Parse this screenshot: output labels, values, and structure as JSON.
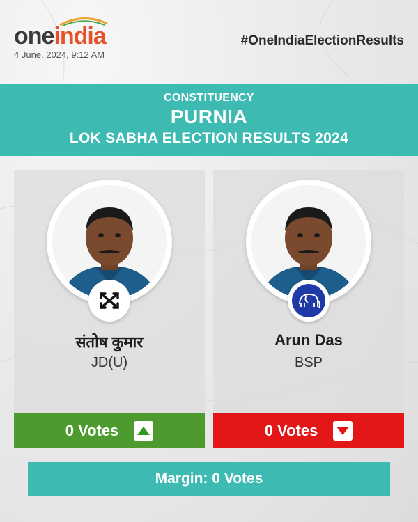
{
  "header": {
    "logo": {
      "part1": "one",
      "part2": "india"
    },
    "date": "4 June, 2024, 9:12 AM",
    "hashtag": "#OneIndiaElectionResults"
  },
  "banner": {
    "label": "CONSTITUENCY",
    "constituency": "PURNIA",
    "title": "LOK SABHA ELECTION RESULTS 2024"
  },
  "candidates": [
    {
      "name": "संतोष कुमार",
      "party": "JD(U)",
      "votes": "0 Votes",
      "trend": "up",
      "trend_icon": "arrow-up-icon",
      "symbol_icon": "jdu-arrow-symbol-icon",
      "status_color": "#4d9b2f"
    },
    {
      "name": "Arun Das",
      "party": "BSP",
      "votes": "0 Votes",
      "trend": "down",
      "trend_icon": "arrow-down-icon",
      "symbol_icon": "bsp-elephant-symbol-icon",
      "status_color": "#e31618"
    }
  ],
  "margin": {
    "text": "Margin: 0 Votes"
  },
  "colors": {
    "accent": "#3dbab2",
    "logo_orange": "#e8522a",
    "win": "#4d9b2f",
    "lose": "#e31618"
  }
}
